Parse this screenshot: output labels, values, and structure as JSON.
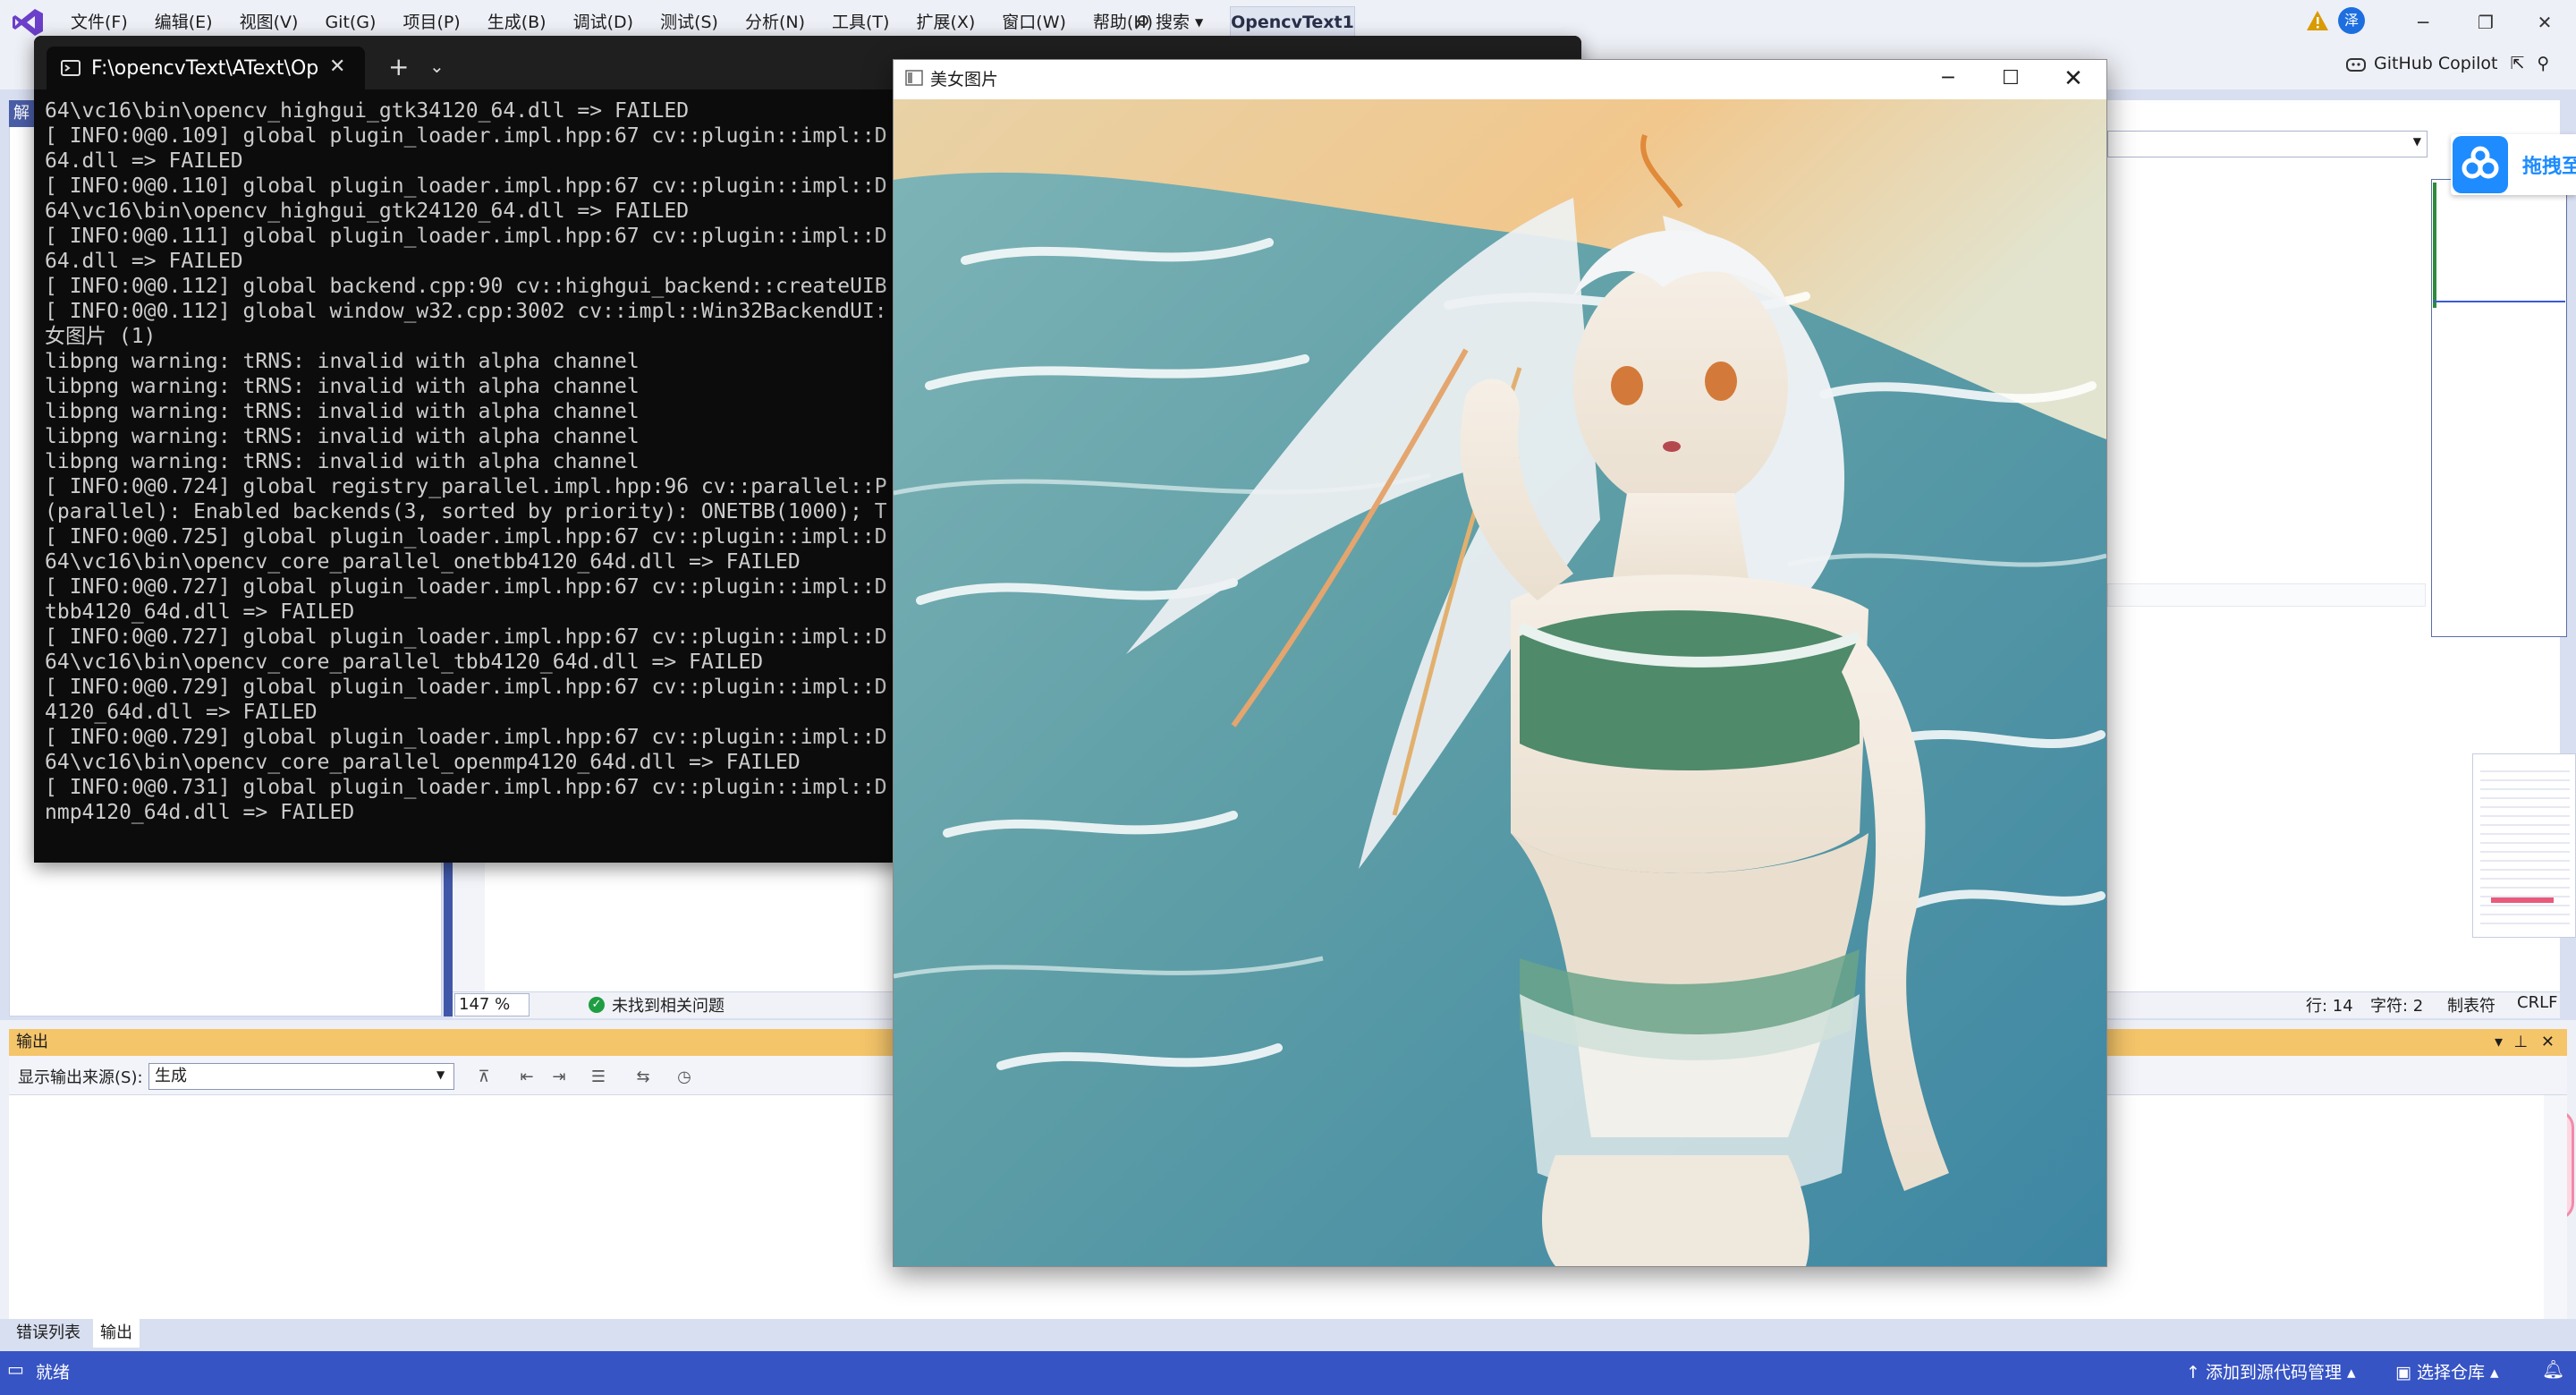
{
  "vs": {
    "menu": [
      "文件(F)",
      "编辑(E)",
      "视图(V)",
      "Git(G)",
      "项目(P)",
      "生成(B)",
      "调试(D)",
      "测试(S)",
      "分析(N)",
      "工具(T)",
      "扩展(X)",
      "窗口(W)",
      "帮助(H)"
    ],
    "search": "搜索",
    "solution": "OpencvText1",
    "account_initial": "泽",
    "copilot": "GitHub Copilot",
    "solution_tab": "解",
    "editor_status": {
      "zoom": "147 %",
      "issues": "未找到相关问题",
      "line": "行: 14",
      "char": "字符: 2",
      "indent": "制表符",
      "eol": "CRLF"
    },
    "output": {
      "title": "输出",
      "source_label": "显示输出来源(S):",
      "source_value": "生成"
    },
    "bottom_tabs": [
      "错误列表",
      "输出"
    ],
    "status": {
      "ready": "就绪",
      "add_source": "添加到源代码管理",
      "select_repo": "选择仓库"
    },
    "floating_tool": "拖拽至"
  },
  "console": {
    "tab_title": "F:\\opencvText\\AText\\Op",
    "lines": [
      "64\\vc16\\bin\\opencv_highgui_gtk34120_64.dll => FAILED",
      "[ INFO:0@0.109] global plugin_loader.impl.hpp:67 cv::plugin::impl::D",
      "64.dll => FAILED",
      "[ INFO:0@0.110] global plugin_loader.impl.hpp:67 cv::plugin::impl::D",
      "64\\vc16\\bin\\opencv_highgui_gtk24120_64.dll => FAILED",
      "[ INFO:0@0.111] global plugin_loader.impl.hpp:67 cv::plugin::impl::D",
      "64.dll => FAILED",
      "[ INFO:0@0.112] global backend.cpp:90 cv::highgui_backend::createUIB",
      "[ INFO:0@0.112] global window_w32.cpp:3002 cv::impl::Win32BackendUI:",
      "女图片 (1)",
      "libpng warning: tRNS: invalid with alpha channel",
      "libpng warning: tRNS: invalid with alpha channel",
      "libpng warning: tRNS: invalid with alpha channel",
      "libpng warning: tRNS: invalid with alpha channel",
      "libpng warning: tRNS: invalid with alpha channel",
      "[ INFO:0@0.724] global registry_parallel.impl.hpp:96 cv::parallel::P",
      "(parallel): Enabled backends(3, sorted by priority): ONETBB(1000); T",
      "[ INFO:0@0.725] global plugin_loader.impl.hpp:67 cv::plugin::impl::D",
      "64\\vc16\\bin\\opencv_core_parallel_onetbb4120_64d.dll => FAILED",
      "[ INFO:0@0.727] global plugin_loader.impl.hpp:67 cv::plugin::impl::D",
      "tbb4120_64d.dll => FAILED",
      "[ INFO:0@0.727] global plugin_loader.impl.hpp:67 cv::plugin::impl::D",
      "64\\vc16\\bin\\opencv_core_parallel_tbb4120_64d.dll => FAILED",
      "[ INFO:0@0.729] global plugin_loader.impl.hpp:67 cv::plugin::impl::D",
      "4120_64d.dll => FAILED",
      "[ INFO:0@0.729] global plugin_loader.impl.hpp:67 cv::plugin::impl::D",
      "64\\vc16\\bin\\opencv_core_parallel_openmp4120_64d.dll => FAILED",
      "[ INFO:0@0.731] global plugin_loader.impl.hpp:67 cv::plugin::impl::D",
      "nmp4120_64d.dll => FAILED"
    ]
  },
  "image_window": {
    "title": "美女图片"
  },
  "colors": {
    "vs_accent": "#3754c4",
    "output_header": "#f5c56a",
    "console_bg": "#0c0c0c",
    "console_text": "#cccccc"
  }
}
